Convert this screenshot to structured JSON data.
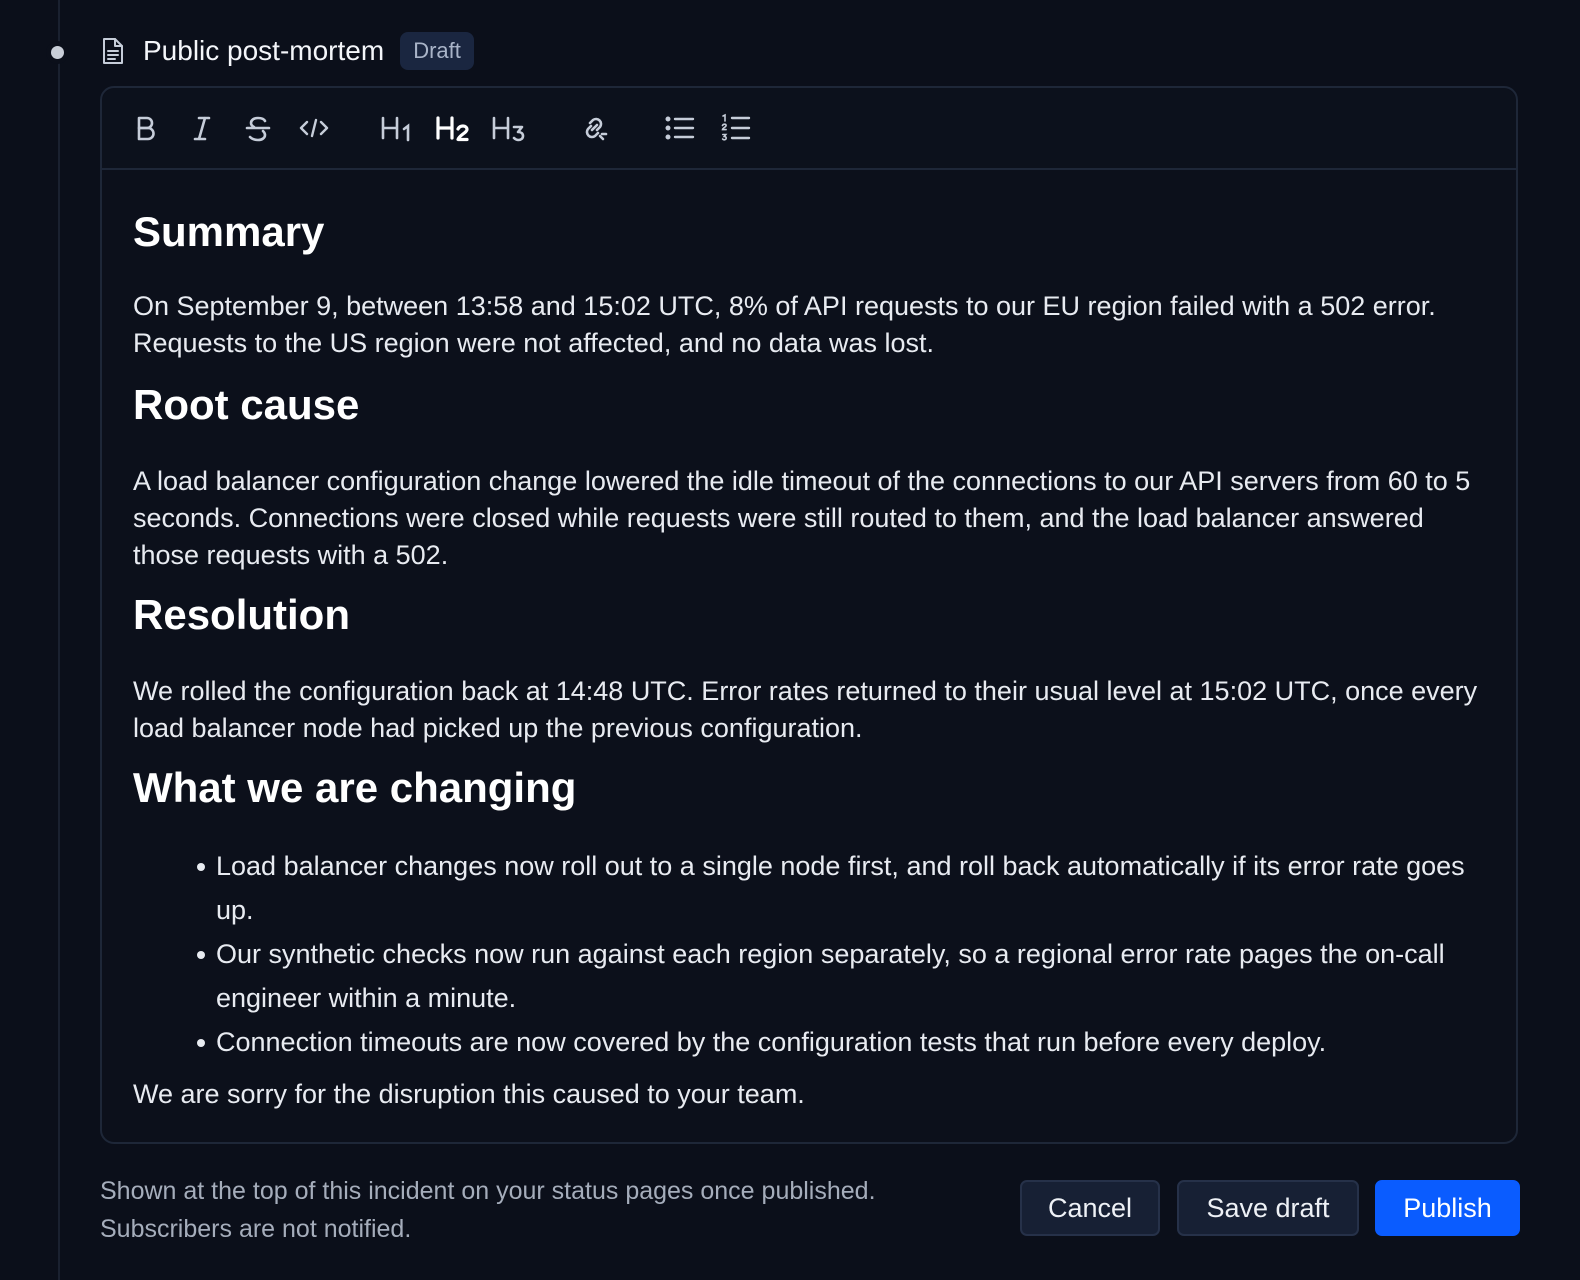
{
  "header": {
    "title": "Public post-mortem",
    "badge": "Draft",
    "icon": "document-icon"
  },
  "toolbar": {
    "buttons": [
      {
        "name": "bold",
        "icon": "bold-icon"
      },
      {
        "name": "italic",
        "icon": "italic-icon"
      },
      {
        "name": "strikethrough",
        "icon": "strikethrough-icon"
      },
      {
        "name": "code",
        "icon": "code-icon"
      },
      {
        "name": "heading-1",
        "icon": "heading-1-icon"
      },
      {
        "name": "heading-2",
        "icon": "heading-2-icon",
        "active": true
      },
      {
        "name": "heading-3",
        "icon": "heading-3-icon"
      },
      {
        "name": "link",
        "icon": "link-icon"
      },
      {
        "name": "bullet-list",
        "icon": "bullet-list-icon"
      },
      {
        "name": "numbered-list",
        "icon": "numbered-list-icon"
      }
    ]
  },
  "document": {
    "summary_heading": "Summary",
    "summary_text": "On September 9, between 13:58 and 15:02 UTC, 8% of API requests to our EU region failed with a 502 error. Requests to the US region were not affected, and no data was lost.",
    "root_cause_heading": "Root cause",
    "root_cause_text": "A load balancer configuration change lowered the idle timeout of the connections to our API servers from 60 to 5 seconds. Connections were closed while requests were still routed to them, and the load balancer answered those requests with a 502.",
    "resolution_heading": "Resolution",
    "resolution_text": "We rolled the configuration back at 14:48 UTC. Error rates returned to their usual level at 15:02 UTC, once every load balancer node had picked up the previous configuration.",
    "changes_heading": "What we are changing",
    "changes": [
      "Load balancer changes now roll out to a single node first, and roll back automatically if its error rate goes up.",
      "Our synthetic checks now run against each region separately, so a regional error rate pages the on-call engineer within a minute.",
      "Connection timeouts are now covered by the configuration tests that run before every deploy."
    ],
    "closing_text": "We are sorry for the disruption this caused to your team."
  },
  "footer": {
    "note_line1": "Shown at the top of this incident on your status pages once published.",
    "note_line2": "Subscribers are not notified.",
    "cancel_label": "Cancel",
    "save_label": "Save draft",
    "publish_label": "Publish"
  },
  "colors": {
    "background": "#0b0f1a",
    "accent": "#0a5cff",
    "badge_bg": "#1a2640"
  }
}
